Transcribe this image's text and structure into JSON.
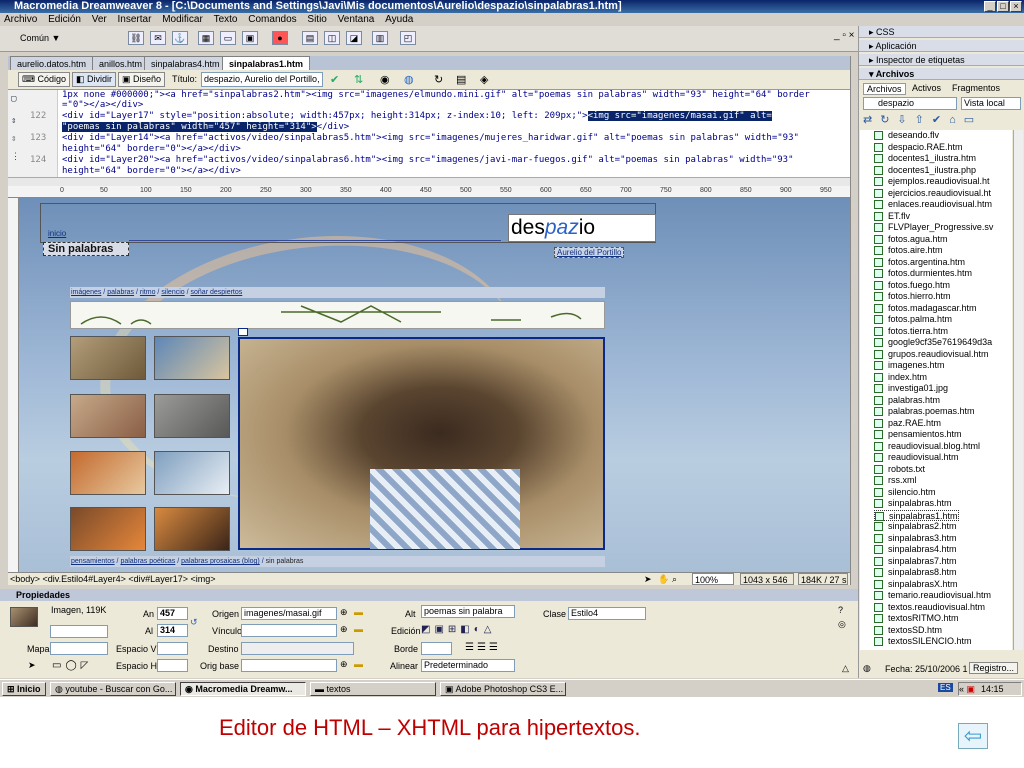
{
  "window": {
    "title": "Macromedia Dreamweaver 8 - [C:\\Documents and Settings\\Javi\\Mis documentos\\Aurelio\\despazio\\sinpalabras1.htm]",
    "controls": [
      "_",
      "□",
      "×"
    ]
  },
  "menu": [
    "Archivo",
    "Edición",
    "Ver",
    "Insertar",
    "Modificar",
    "Texto",
    "Comandos",
    "Sitio",
    "Ventana",
    "Ayuda"
  ],
  "insertbar": {
    "category": "Común ▼"
  },
  "doc_tabs": [
    "aurelio.datos.htm",
    "anillos.htm",
    "sinpalabras4.htm",
    "sinpalabras1.htm"
  ],
  "doc_toolbar": {
    "code": "Código",
    "split": "Dividir",
    "design": "Diseño",
    "title_label": "Título:",
    "title_value": "despazio, Aurelio del Portillo, p"
  },
  "code_lines": [
    {
      "no": "",
      "text": "1px none #000000;\"><a href=\"sinpalabras2.htm\"><img src=\"imagenes/elmundo.mini.gif\" alt=\"poemas sin palabras\" width=\"93\" height=\"64\" border"
    },
    {
      "no": "",
      "text": "=\"0\"></a></div>"
    },
    {
      "no": "122",
      "text": "  <div id=\"Layer17\" style=\"position:absolute; width:457px; height:314px; z-index:10; left: 209px;\">",
      "sel": "<img src=\"imagenes/masai.gif\" alt="
    },
    {
      "no": "",
      "text": "",
      "sel": "\"poemas sin palabras\" width=\"457\" height=\"314\">",
      "after": "</div>"
    },
    {
      "no": "123",
      "text": "  <div id=\"Layer14\"><a href=\"activos/video/sinpalabras5.htm\"><img src=\"imagenes/mujeres_haridwar.gif\" alt=\"poemas sin palabras\" width=\"93\""
    },
    {
      "no": "",
      "text": " height=\"64\" border=\"0\"></a></div>"
    },
    {
      "no": "124",
      "text": "  <div id=\"Layer20\"><a href=\"activos/video/sinpalabras6.htm\"><img src=\"imagenes/javi-mar-fuegos.gif\" alt=\"poemas sin palabras\" width=\"93\""
    },
    {
      "no": "",
      "text": "height=\"64\" border=\"0\"></a></div>"
    }
  ],
  "ruler_marks": [
    "0",
    "50",
    "100",
    "150",
    "200",
    "250",
    "300",
    "350",
    "400",
    "450",
    "500",
    "550",
    "600",
    "650",
    "700",
    "750",
    "800",
    "850",
    "900",
    "950",
    "1000"
  ],
  "page": {
    "inicio": "inicio",
    "heading": "Sin palabras",
    "logo_prefix": "des",
    "logo_mid": "paz",
    "logo_suffix": "io",
    "author_link": "Aurelio del Portillo",
    "breadcrumb_top": [
      "imágenes",
      "palabras",
      "ritmo",
      "silencio",
      "soñar despiertos"
    ],
    "breadcrumb_bottom": [
      "pensamientos",
      "palabras poéticas",
      "palabras prosaicas (blog)"
    ],
    "breadcrumb_bottom_last": "sin palabras"
  },
  "status": {
    "tags": "<body> <div.Estilo4#Layer4> <div#Layer17> <img>",
    "zoom": "100%",
    "size": "1043 x 546",
    "weight": "184K / 27 s"
  },
  "properties": {
    "header": "Propiedades",
    "type": "Imagen, 119K",
    "an_label": "An",
    "an": "457",
    "al_label": "Al",
    "al": "314",
    "origen_label": "Origen",
    "origen": "imagenes/masai.gif",
    "vinculo_label": "Vínculo",
    "vinculo": "",
    "alt_label": "Alt",
    "alt": "poemas sin palabra",
    "edicion_label": "Edición",
    "clase_label": "Clase",
    "clase": "Estilo4",
    "mapa_label": "Mapa",
    "mapa": "",
    "espv_label": "Espacio V",
    "espv": "",
    "destino_label": "Destino",
    "destino": "",
    "borde_label": "Borde",
    "borde": "",
    "esph_label": "Espacio H",
    "esph": "",
    "origbase_label": "Orig base",
    "origbase": "",
    "alinear_label": "Alinear",
    "alinear": "Predeterminado"
  },
  "right_panels": [
    "CSS",
    "Aplicación",
    "Inspector de etiquetas",
    "Archivos"
  ],
  "files_tabs": [
    "Archivos",
    "Activos",
    "Fragmentos"
  ],
  "site_select": "despazio",
  "view_select": "Vista local",
  "files": [
    "deseando.flv",
    "despacio.RAE.htm",
    "docentes1_ilustra.htm",
    "docentes1_ilustra.php",
    "ejemplos.reaudiovisual.ht",
    "ejercicios.reaudiovisual.ht",
    "enlaces.reaudiovisual.htm",
    "ET.flv",
    "FLVPlayer_Progressive.sv",
    "fotos.agua.htm",
    "fotos.aire.htm",
    "fotos.argentina.htm",
    "fotos.durmientes.htm",
    "fotos.fuego.htm",
    "fotos.hierro.htm",
    "fotos.madagascar.htm",
    "fotos.palma.htm",
    "fotos.tierra.htm",
    "google9cf35e7619649d3a",
    "grupos.reaudiovisual.htm",
    "imagenes.htm",
    "index.htm",
    "investiga01.jpg",
    "palabras.htm",
    "palabras.poemas.htm",
    "paz.RAE.htm",
    "pensamientos.htm",
    "reaudiovisual.blog.html",
    "reaudiovisual.htm",
    "robots.txt",
    "rss.xml",
    "silencio.htm",
    "sinpalabras.htm",
    "sinpalabras1.htm",
    "sinpalabras2.htm",
    "sinpalabras3.htm",
    "sinpalabras4.htm",
    "sinpalabras7.htm",
    "sinpalabras8.htm",
    "sinpalabrasX.htm",
    "temario.reaudiovisual.htm",
    "textos.reaudiovisual.htm",
    "textosRITMO.htm",
    "textosSD.htm",
    "textosSILENCIO.htm"
  ],
  "files_footer": {
    "fecha": "Fecha: 25/10/2006 1",
    "registro": "Registro..."
  },
  "taskbar": {
    "start": "Inicio",
    "items": [
      "youtube - Buscar con Go...",
      "Macromedia Dreamw...",
      "textos",
      "Adobe Photoshop CS3 E..."
    ],
    "lang": "ES",
    "clock": "14:15"
  },
  "caption": "Editor de HTML – XHTML para hipertextos.",
  "colors": {
    "accent": "#0a246a",
    "caption": "#c00000",
    "design_bg": "#9fb8d6"
  }
}
